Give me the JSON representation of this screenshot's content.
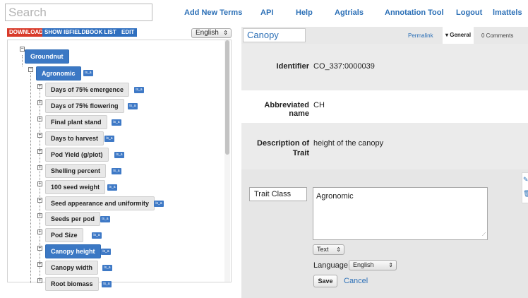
{
  "search": {
    "placeholder": "Search"
  },
  "nav": [
    "Add New Terms",
    "API",
    "Help",
    "Agtrials",
    "Annotation Tool",
    "Logout",
    "lmattels"
  ],
  "toolbar": {
    "download": "DOWNLOAD",
    "show_list": "SHOW IBFIELDBOOK LIST",
    "edit": "EDIT",
    "language": "English"
  },
  "tree": {
    "root": "Groundnut",
    "group": "Agronomic",
    "badge": "is_a",
    "items": [
      "Days of 75% emergence",
      "Days of 75% flowering",
      "Final plant stand",
      "Days to harvest",
      "Pod Yield (g/plot)",
      "Shelling percent",
      "100 seed weight",
      "Seed appearance and uniformity",
      "Seeds per pod",
      "Pod Size",
      "Canopy height",
      "Canopy width",
      "Root biomass"
    ],
    "selected": "Canopy height"
  },
  "detail": {
    "title": "Canopy height",
    "permalink": "Permalink",
    "tab_general": "General",
    "tab_comments": "0 Comments",
    "identifier_label": "Identifier",
    "identifier_value": "CO_337:0000039",
    "abbrev_label": "Abbreviated name",
    "abbrev_value": "CH",
    "desc_label_1": "Description of",
    "desc_label_2": "Trait",
    "desc_value": "height of the canopy"
  },
  "editor": {
    "field_label": "Trait Class",
    "text_value": "Agronomic",
    "type_value": "Text",
    "language_label": "Language:",
    "language_value": "English",
    "save": "Save",
    "cancel": "Cancel"
  },
  "colors": {
    "accent": "#2b6fb6",
    "selected": "#3b78c4",
    "download": "#d83a2a"
  }
}
